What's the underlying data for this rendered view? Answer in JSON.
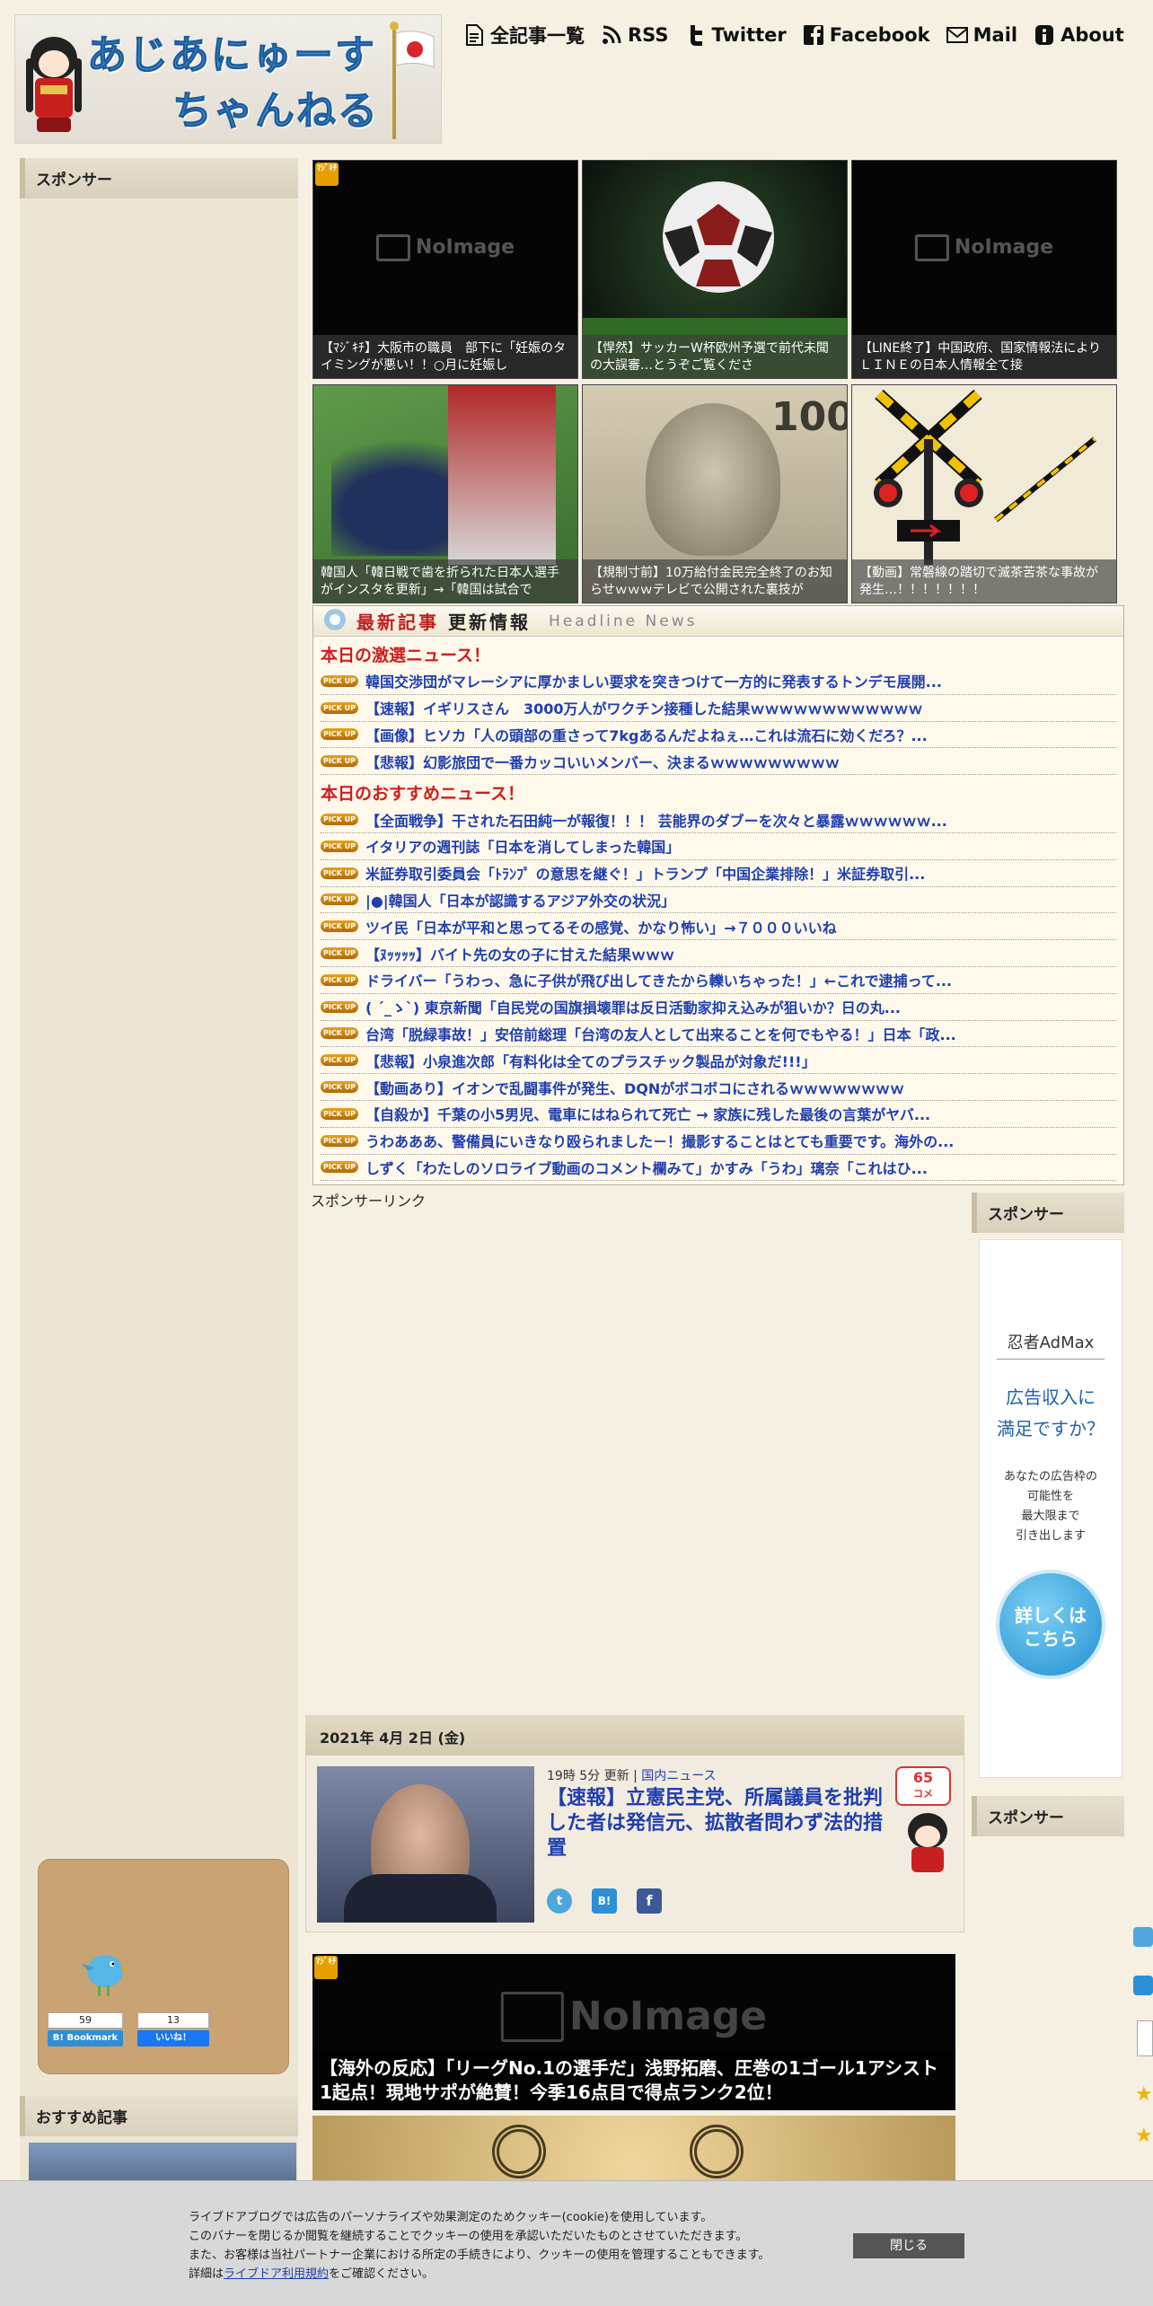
{
  "site": {
    "title_line1": "あじあにゅーす",
    "title_line2": "ちゃんねる"
  },
  "nav": [
    {
      "label": "全記事一覧",
      "icon": "document-icon"
    },
    {
      "label": "RSS",
      "icon": "rss-icon"
    },
    {
      "label": "Twitter",
      "icon": "twitter-icon"
    },
    {
      "label": "Facebook",
      "icon": "facebook-icon"
    },
    {
      "label": "Mail",
      "icon": "mail-icon"
    },
    {
      "label": "About",
      "icon": "info-icon"
    }
  ],
  "sidebar_left": {
    "sponsor": "スポンサー",
    "recommended": "おすすめ記事",
    "hatena_count": "59",
    "hatena_label": "B! Bookmark",
    "fb_count": "13",
    "fb_label": "いいね！"
  },
  "noimage": "NoImage",
  "badge": "ﾏｼﾞｷﾁ",
  "thumbs": [
    "【ﾏｼﾞｷﾁ】大阪市の職員　部下に「妊娠のタイミングが悪い！！○月に妊娠し",
    "【悍然】サッカーW杯欧州予選で前代未聞の大誤審…とうぞご覧くださ",
    "【LINE終了】中国政府、国家情報法によりＬＩＮＥの日本人情報全て接",
    "韓国人「韓日戦で歯を折られた日本人選手がインスタを更新」→「韓国は試合で",
    "【規制寸前】10万給付金民完全終了のお知らせｗｗｗテレビで公開された裏技が",
    "【動画】常磐線の踏切で滅茶苦茶な事故が発生…！！！！！！！"
  ],
  "headlines": {
    "title_a": "最新記事",
    "title_b": "更新情報",
    "title_c": "Headline News",
    "pick_label": "PICK UP",
    "section1": "本日の激選ニュース！",
    "section1_items": [
      "韓国交渉団がマレーシアに厚かましい要求を突きつけて一方的に発表するトンデモ展開...",
      "【速報】イギリスさん　3000万人がワクチン接種した結果ｗｗｗｗｗｗｗｗｗｗｗｗ",
      "【画像】ヒソカ「人の頭部の重さって7kgあるんだよねぇ…これは流石に効くだろ？...",
      "【悲報】幻影旅団で一番カッコいいメンバー、決まるｗｗｗｗｗｗｗｗｗ"
    ],
    "section2": "本日のおすすめニュース！",
    "section2_items": [
      "【全面戦争】干された石田純一が報復！！！ 芸能界のダブーを次々と暴露ｗｗｗｗｗｗ...",
      "イタリアの週刊誌「日本を消してしまった韓国」",
      "米証券取引委員会「ﾄﾗﾝﾌﾟ の意思を継ぐ！」トランプ「中国企業排除！」米証券取引...",
      "|●|韓国人「日本が認識するアジア外交の状況」",
      "ツイ民「日本が平和と思ってるその感覚、かなり怖い」→７０００いいね",
      "【ﾇｯｯｯｯ】バイト先の女の子に甘えた結果ｗｗｗ",
      "ドライバー「うわっ、急に子供が飛び出してきたから轢いちゃった！」←これで逮捕って...",
      "( ´_ゝ`) 東京新聞「自民党の国旗損壊罪は反日活動家抑え込みが狙いか？日の丸...",
      "台湾「脱緑事故！」安倍前総理「台湾の友人として出来ることを何でもやる！」日本「政...",
      "【悲報】小泉進次郎「有料化は全てのプラスチック製品が対象だ!!!」",
      "【動画あり】イオンで乱闘事件が発生、DQNがボコボコにされるｗｗｗｗｗｗｗｗ",
      "【自殺か】千葉の小5男児、電車にはねられて死亡 → 家族に残した最後の言葉がヤバ...",
      "うわあああ、警備員にいきなり殴られました－！撮影することはとても重要です。海外の...",
      "しずく「わたしのソロライブ動画のコメント欄みて」かすみ「うわ」璃奈「これはひ..."
    ]
  },
  "sponsor_link": "スポンサーリンク",
  "right": {
    "sponsor1": "スポンサー",
    "sponsor2": "スポンサー",
    "admax_brand": "忍者AdMax",
    "admax_h1": "広告収入に",
    "admax_h2": "満足ですか？",
    "admax_b1": "あなたの広告枠の",
    "admax_b2": "可能性を",
    "admax_b3": "最大限まで",
    "admax_b4": "引き出します",
    "admax_btn1": "詳しくは",
    "admax_btn2": "こちら"
  },
  "article": {
    "date": "2021年 4月 2日 (金)",
    "time": "19時 5分 更新",
    "category": "国内ニュース",
    "title": "【速報】立憲民主党、所属議員を批判した者は発信元、拡散者問わず法的措置",
    "comments": "65",
    "comments_label": "コメ"
  },
  "feature1": "【海外の反応】「リーグNo.1の選手だ」浅野拓磨、圧巻の1ゴール1アシスト1起点！現地サポが絶賛！今季16点目で得点ランク2位！",
  "cookie": {
    "line1": "ライブドアブログでは広告のパーソナライズや効果測定のためクッキー(cookie)を使用しています。",
    "line2": "このバナーを閉じるか閲覧を継続することでクッキーの使用を承認いただいたものとさせていただきます。",
    "line3": "また、お客様は当社パートナー企業における所定の手続きにより、クッキーの使用を管理することもできます。",
    "line4_pre": "詳細は",
    "line4_link": "ライブドア利用規約",
    "line4_post": "をご確認ください。",
    "close": "閉じる"
  }
}
